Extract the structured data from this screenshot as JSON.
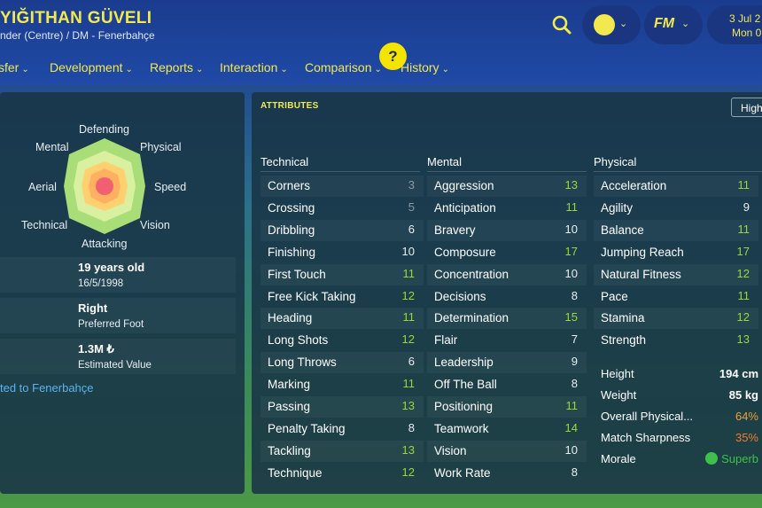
{
  "header": {
    "player_name": "YIĞITHAN GÜVELI",
    "player_sub": "nder (Centre) / DM - Fenerbahçe",
    "help_label": "?",
    "fm_label": "FM",
    "date_line1": "3 Jul 2",
    "date_line2": "Mon 0"
  },
  "nav": {
    "items": [
      {
        "label": "sfer"
      },
      {
        "label": "Development"
      },
      {
        "label": "Reports"
      },
      {
        "label": "Interaction"
      },
      {
        "label": "Comparison"
      },
      {
        "label": "History"
      }
    ],
    "chevron": "⌄"
  },
  "radar": {
    "labels": [
      "Defending",
      "Physical",
      "Speed",
      "Vision",
      "Attacking",
      "Technical",
      "Aerial",
      "Mental"
    ]
  },
  "profile": {
    "age": "19 years old",
    "dob": "16/5/1998",
    "foot": "Right",
    "foot_label": "Preferred Foot",
    "value": "1.3M ₺",
    "value_label": "Estimated Value",
    "transfer_text": "ted to Fenerbahçe"
  },
  "attributes": {
    "title": "ATTRIBUTES",
    "filter_label": "High",
    "technical": {
      "header": "Technical",
      "rows": [
        {
          "name": "Corners",
          "value": "3"
        },
        {
          "name": "Crossing",
          "value": "5"
        },
        {
          "name": "Dribbling",
          "value": "6"
        },
        {
          "name": "Finishing",
          "value": "10"
        },
        {
          "name": "First Touch",
          "value": "11"
        },
        {
          "name": "Free Kick Taking",
          "value": "12"
        },
        {
          "name": "Heading",
          "value": "11"
        },
        {
          "name": "Long Shots",
          "value": "12"
        },
        {
          "name": "Long Throws",
          "value": "6"
        },
        {
          "name": "Marking",
          "value": "11"
        },
        {
          "name": "Passing",
          "value": "13"
        },
        {
          "name": "Penalty Taking",
          "value": "8"
        },
        {
          "name": "Tackling",
          "value": "13"
        },
        {
          "name": "Technique",
          "value": "12"
        }
      ]
    },
    "mental": {
      "header": "Mental",
      "rows": [
        {
          "name": "Aggression",
          "value": "13"
        },
        {
          "name": "Anticipation",
          "value": "11"
        },
        {
          "name": "Bravery",
          "value": "10"
        },
        {
          "name": "Composure",
          "value": "17"
        },
        {
          "name": "Concentration",
          "value": "10"
        },
        {
          "name": "Decisions",
          "value": "8"
        },
        {
          "name": "Determination",
          "value": "15"
        },
        {
          "name": "Flair",
          "value": "7"
        },
        {
          "name": "Leadership",
          "value": "9"
        },
        {
          "name": "Off The Ball",
          "value": "8"
        },
        {
          "name": "Positioning",
          "value": "11"
        },
        {
          "name": "Teamwork",
          "value": "14"
        },
        {
          "name": "Vision",
          "value": "10"
        },
        {
          "name": "Work Rate",
          "value": "8"
        }
      ]
    },
    "physical": {
      "header": "Physical",
      "rows": [
        {
          "name": "Acceleration",
          "value": "11"
        },
        {
          "name": "Agility",
          "value": "9"
        },
        {
          "name": "Balance",
          "value": "11"
        },
        {
          "name": "Jumping Reach",
          "value": "17"
        },
        {
          "name": "Natural Fitness",
          "value": "12"
        },
        {
          "name": "Pace",
          "value": "11"
        },
        {
          "name": "Stamina",
          "value": "12"
        },
        {
          "name": "Strength",
          "value": "13"
        }
      ]
    },
    "stats": [
      {
        "name": "Height",
        "value": "194 cm"
      },
      {
        "name": "Weight",
        "value": "85 kg"
      },
      {
        "name": "Overall Physical...",
        "value": "64%",
        "color": "#f0a030"
      },
      {
        "name": "Match Sharpness",
        "value": "35%",
        "color": "#f07a30"
      },
      {
        "name": "Morale",
        "value": "Superb",
        "color": "#3ec04a"
      }
    ]
  },
  "colors": {
    "accent_yellow": "#f2e94e",
    "value_green": "#9bd73c",
    "value_grey": "#8a9aa4",
    "value_white": "#e8eef2"
  }
}
